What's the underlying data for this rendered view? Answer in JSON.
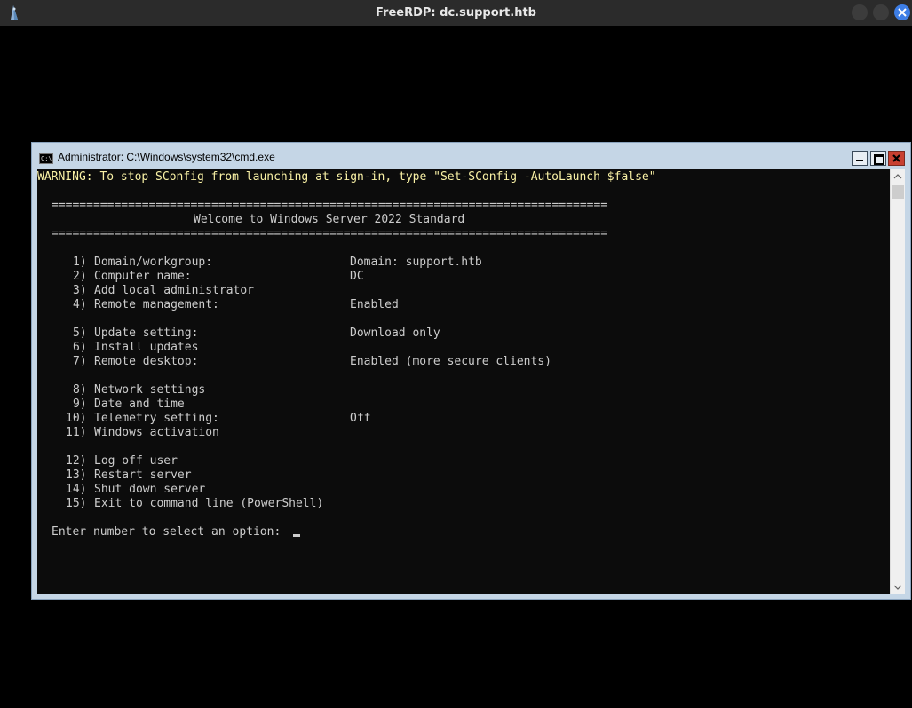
{
  "rdp_window": {
    "title": "FreeRDP: dc.support.htb"
  },
  "cmd_window": {
    "title": "Administrator: C:\\Windows\\system32\\cmd.exe",
    "icon_text": "C:\\"
  },
  "console": {
    "warning": "WARNING: To stop SConfig from launching at sign-in, type \"Set-SConfig -AutoLaunch $false\"",
    "separator_top": "================================================================================",
    "welcome": "Welcome to Windows Server 2022 Standard",
    "separator_bottom": "================================================================================",
    "menu": [
      {
        "num": "1)",
        "label": "Domain/workgroup:",
        "value": "Domain: support.htb"
      },
      {
        "num": "2)",
        "label": "Computer name:",
        "value": "DC"
      },
      {
        "num": "3)",
        "label": "Add local administrator",
        "value": ""
      },
      {
        "num": "4)",
        "label": "Remote management:",
        "value": "Enabled"
      },
      {
        "num": "5)",
        "label": "Update setting:",
        "value": "Download only"
      },
      {
        "num": "6)",
        "label": "Install updates",
        "value": ""
      },
      {
        "num": "7)",
        "label": "Remote desktop:",
        "value": "Enabled (more secure clients)"
      },
      {
        "num": "8)",
        "label": "Network settings",
        "value": ""
      },
      {
        "num": "9)",
        "label": "Date and time",
        "value": ""
      },
      {
        "num": "10)",
        "label": "Telemetry setting:",
        "value": "Off"
      },
      {
        "num": "11)",
        "label": "Windows activation",
        "value": ""
      },
      {
        "num": "12)",
        "label": "Log off user",
        "value": ""
      },
      {
        "num": "13)",
        "label": "Restart server",
        "value": ""
      },
      {
        "num": "14)",
        "label": "Shut down server",
        "value": ""
      },
      {
        "num": "15)",
        "label": "Exit to command line (PowerShell)",
        "value": ""
      }
    ],
    "prompt": "Enter number to select an option:"
  },
  "colors": {
    "console_bg": "#0c0c0c",
    "console_text": "#cccccc",
    "warning_text": "#f9f1a5",
    "cmd_frame": "#c5d6e6",
    "close_red": "#c84031",
    "rdp_close_blue": "#3d7ee6"
  },
  "icons": [
    "freerdp-app-icon",
    "minimize-icon",
    "maximize-icon",
    "close-icon",
    "cmd-icon",
    "scroll-up-arrow-icon",
    "scroll-down-arrow-icon"
  ]
}
